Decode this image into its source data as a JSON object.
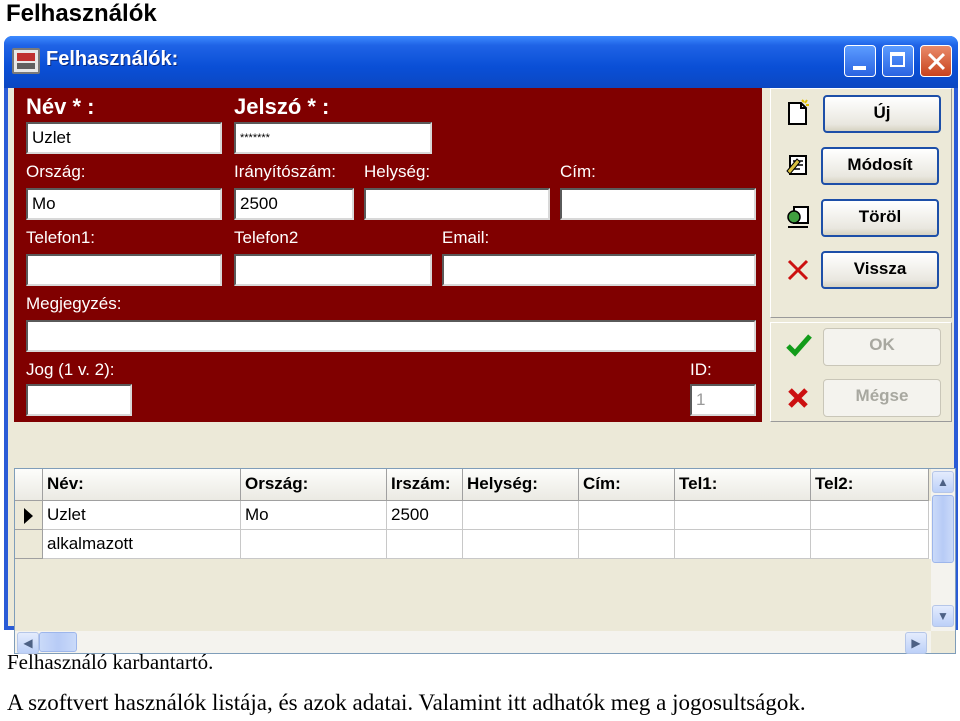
{
  "page_heading": "Felhasználók",
  "window": {
    "title": "Felhasználók:"
  },
  "form": {
    "nev_label": "Név * :",
    "nev_value": "Uzlet",
    "jelszo_label": "Jelszó * :",
    "jelszo_value": "*******",
    "orszag_label": "Ország:",
    "orszag_value": "Mo",
    "iranyitoszam_label": "Irányítószám:",
    "iranyitoszam_value": "2500",
    "helyseg_label": "Helység:",
    "helyseg_value": "",
    "cim_label": "Cím:",
    "cim_value": "",
    "telefon1_label": "Telefon1:",
    "telefon1_value": "",
    "telefon2_label": "Telefon2",
    "telefon2_value": "",
    "email_label": "Email:",
    "email_value": "",
    "megjegyzes_label": "Megjegyzés:",
    "megjegyzes_value": "",
    "jog_label": "Jog (1 v. 2):",
    "jog_value": "",
    "id_label": "ID:",
    "id_value": "1"
  },
  "buttons": {
    "uj": "Új",
    "modosit": "Módosít",
    "torol": "Töröl",
    "vissza": "Vissza",
    "ok": "OK",
    "megse": "Mégse"
  },
  "grid": {
    "headers": [
      "Név:",
      "Ország:",
      "Irszám:",
      "Helység:",
      "Cím:",
      "Tel1:",
      "Tel2:"
    ],
    "rows": [
      [
        "Uzlet",
        "Mo",
        "2500",
        "",
        "",
        "",
        ""
      ],
      [
        "alkalmazott",
        "",
        "",
        "",
        "",
        "",
        ""
      ]
    ]
  },
  "caption": "Felhasználó karbantartó.",
  "description": "A szoftvert használók listája, és azok adatai. Valamint itt adhatók meg a jogosultságok."
}
